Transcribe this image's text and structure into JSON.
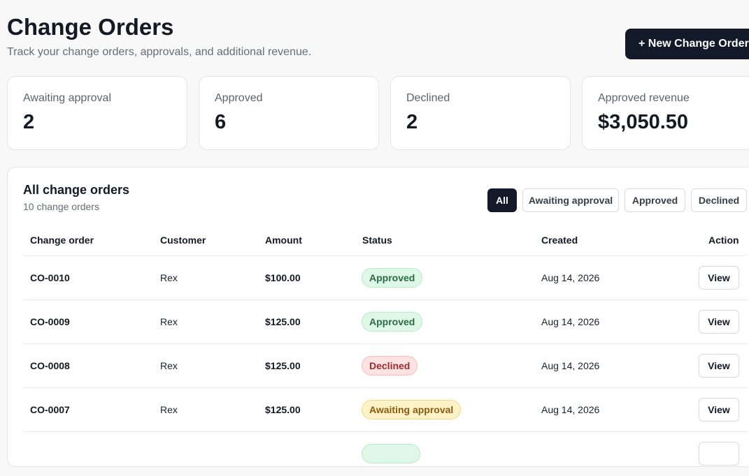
{
  "header": {
    "title": "Change Orders",
    "subtitle": "Track your change orders, approvals, and additional revenue.",
    "new_button_label": "+ New Change Order"
  },
  "stats": [
    {
      "label": "Awaiting approval",
      "value": "2"
    },
    {
      "label": "Approved",
      "value": "6"
    },
    {
      "label": "Declined",
      "value": "2"
    },
    {
      "label": "Approved revenue",
      "value": "$3,050.50"
    }
  ],
  "panel": {
    "title": "All change orders",
    "count": "10 change orders",
    "filters": [
      {
        "label": "All",
        "active": true
      },
      {
        "label": "Awaiting approval",
        "active": false
      },
      {
        "label": "Approved",
        "active": false
      },
      {
        "label": "Declined",
        "active": false
      }
    ],
    "columns": [
      "Change order",
      "Customer",
      "Amount",
      "Status",
      "Created",
      "Action"
    ],
    "rows": [
      {
        "id": "CO-0010",
        "customer": "Rex",
        "amount": "$100.00",
        "status": "Approved",
        "status_kind": "approved",
        "created": "Aug 14, 2026",
        "action": "View"
      },
      {
        "id": "CO-0009",
        "customer": "Rex",
        "amount": "$125.00",
        "status": "Approved",
        "status_kind": "approved",
        "created": "Aug 14, 2026",
        "action": "View"
      },
      {
        "id": "CO-0008",
        "customer": "Rex",
        "amount": "$125.00",
        "status": "Declined",
        "status_kind": "declined",
        "created": "Aug 14, 2026",
        "action": "View"
      },
      {
        "id": "CO-0007",
        "customer": "Rex",
        "amount": "$125.00",
        "status": "Awaiting approval",
        "status_kind": "awaiting",
        "created": "Aug 14, 2026",
        "action": "View"
      },
      {
        "id": "",
        "customer": "",
        "amount": "",
        "status": "",
        "status_kind": "approved",
        "created": "",
        "action": ""
      }
    ]
  },
  "colors": {
    "page_background": "#f8f8f8",
    "primary_button": "#121a29",
    "approved_badge": "#dff7e6",
    "declined_badge": "#fde2e2",
    "awaiting_badge": "#fdf3c7"
  }
}
